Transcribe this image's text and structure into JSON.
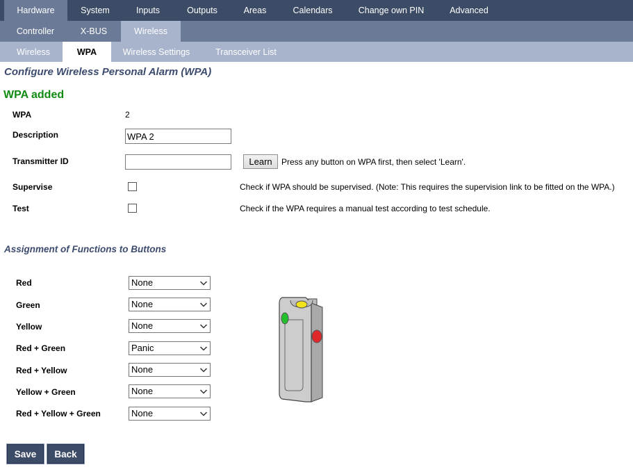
{
  "nav": {
    "primary": [
      "Hardware",
      "System",
      "Inputs",
      "Outputs",
      "Areas",
      "Calendars",
      "Change own PIN",
      "Advanced"
    ],
    "primary_active": "Hardware",
    "secondary": [
      "Controller",
      "X-BUS",
      "Wireless"
    ],
    "secondary_active": "Wireless",
    "tertiary": [
      "Wireless",
      "WPA",
      "Wireless Settings",
      "Transceiver List"
    ],
    "tertiary_active": "WPA"
  },
  "page_title": "Configure Wireless Personal Alarm (WPA)",
  "status_message": "WPA added",
  "form": {
    "wpa_label": "WPA",
    "wpa_value": "2",
    "description_label": "Description",
    "description_value": "WPA 2",
    "transmitter_label": "Transmitter ID",
    "transmitter_value": "",
    "learn_button": "Learn",
    "learn_hint": "Press any button on WPA first, then select 'Learn'.",
    "supervise_label": "Supervise",
    "supervise_checked": false,
    "supervise_hint": "Check if WPA should be supervised. (Note: This requires the supervision link to be fitted on the WPA.)",
    "test_label": "Test",
    "test_checked": false,
    "test_hint": "Check if the WPA requires a manual test according to test schedule."
  },
  "assignment": {
    "title": "Assignment of Functions to Buttons",
    "rows": [
      {
        "label": "Red",
        "value": "None"
      },
      {
        "label": "Green",
        "value": "None"
      },
      {
        "label": "Yellow",
        "value": "None"
      },
      {
        "label": "Red + Green",
        "value": "Panic"
      },
      {
        "label": "Red + Yellow",
        "value": "None"
      },
      {
        "label": "Yellow + Green",
        "value": "None"
      },
      {
        "label": "Red + Yellow + Green",
        "value": "None"
      }
    ]
  },
  "buttons": {
    "save": "Save",
    "back": "Back"
  },
  "colors": {
    "nav_dark": "#3c4b66",
    "nav_mid": "#6b7a96",
    "nav_light": "#a7b4cc",
    "title": "#3c4b6e",
    "success": "#108a10",
    "led_red": "#e0282a",
    "led_green": "#22c02a",
    "led_yellow": "#f2e21a"
  },
  "icons": {
    "dropdown": "chevron-down-icon",
    "device": "wpa-device-illustration"
  }
}
